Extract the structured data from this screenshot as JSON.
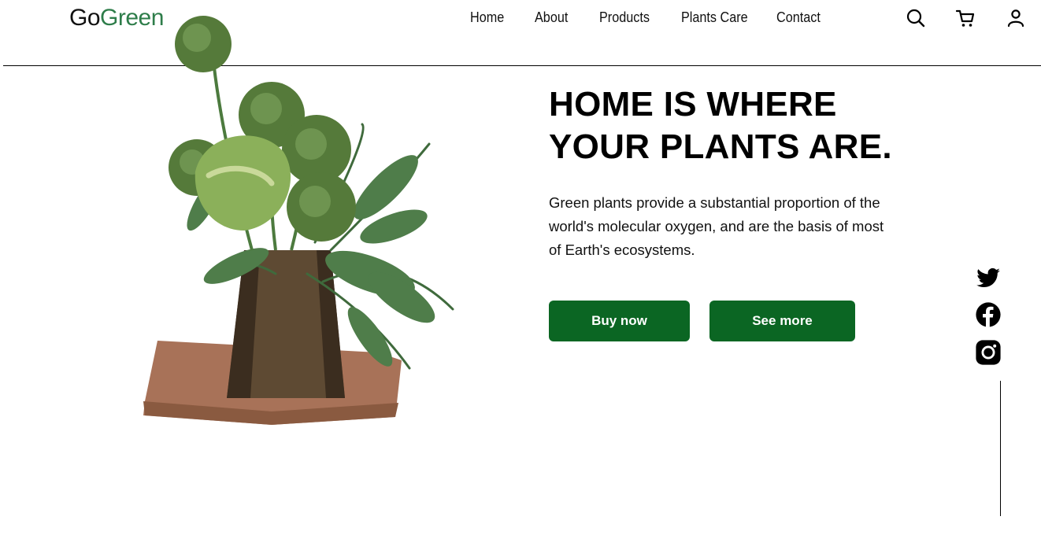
{
  "brand": {
    "part1": "Go",
    "part2": "Green"
  },
  "nav": {
    "items": [
      {
        "label": "Home"
      },
      {
        "label": "About"
      },
      {
        "label": "Products"
      },
      {
        "label": "Plants Care"
      },
      {
        "label": "Contact"
      }
    ]
  },
  "header_icons": [
    "search-icon",
    "cart-icon",
    "user-icon"
  ],
  "hero": {
    "headline_line1": "HOME IS WHERE",
    "headline_line2": "YOUR PLANTS ARE.",
    "description": "Green plants provide a substantial proportion of the world's molecular oxygen, and are the basis of most of Earth's ecosystems.",
    "buy_label": "Buy now",
    "more_label": "See more"
  },
  "social_icons": [
    "twitter-icon",
    "facebook-icon",
    "instagram-icon"
  ],
  "colors": {
    "brand_green": "#2e7d4a",
    "button_green": "#0b6623"
  }
}
